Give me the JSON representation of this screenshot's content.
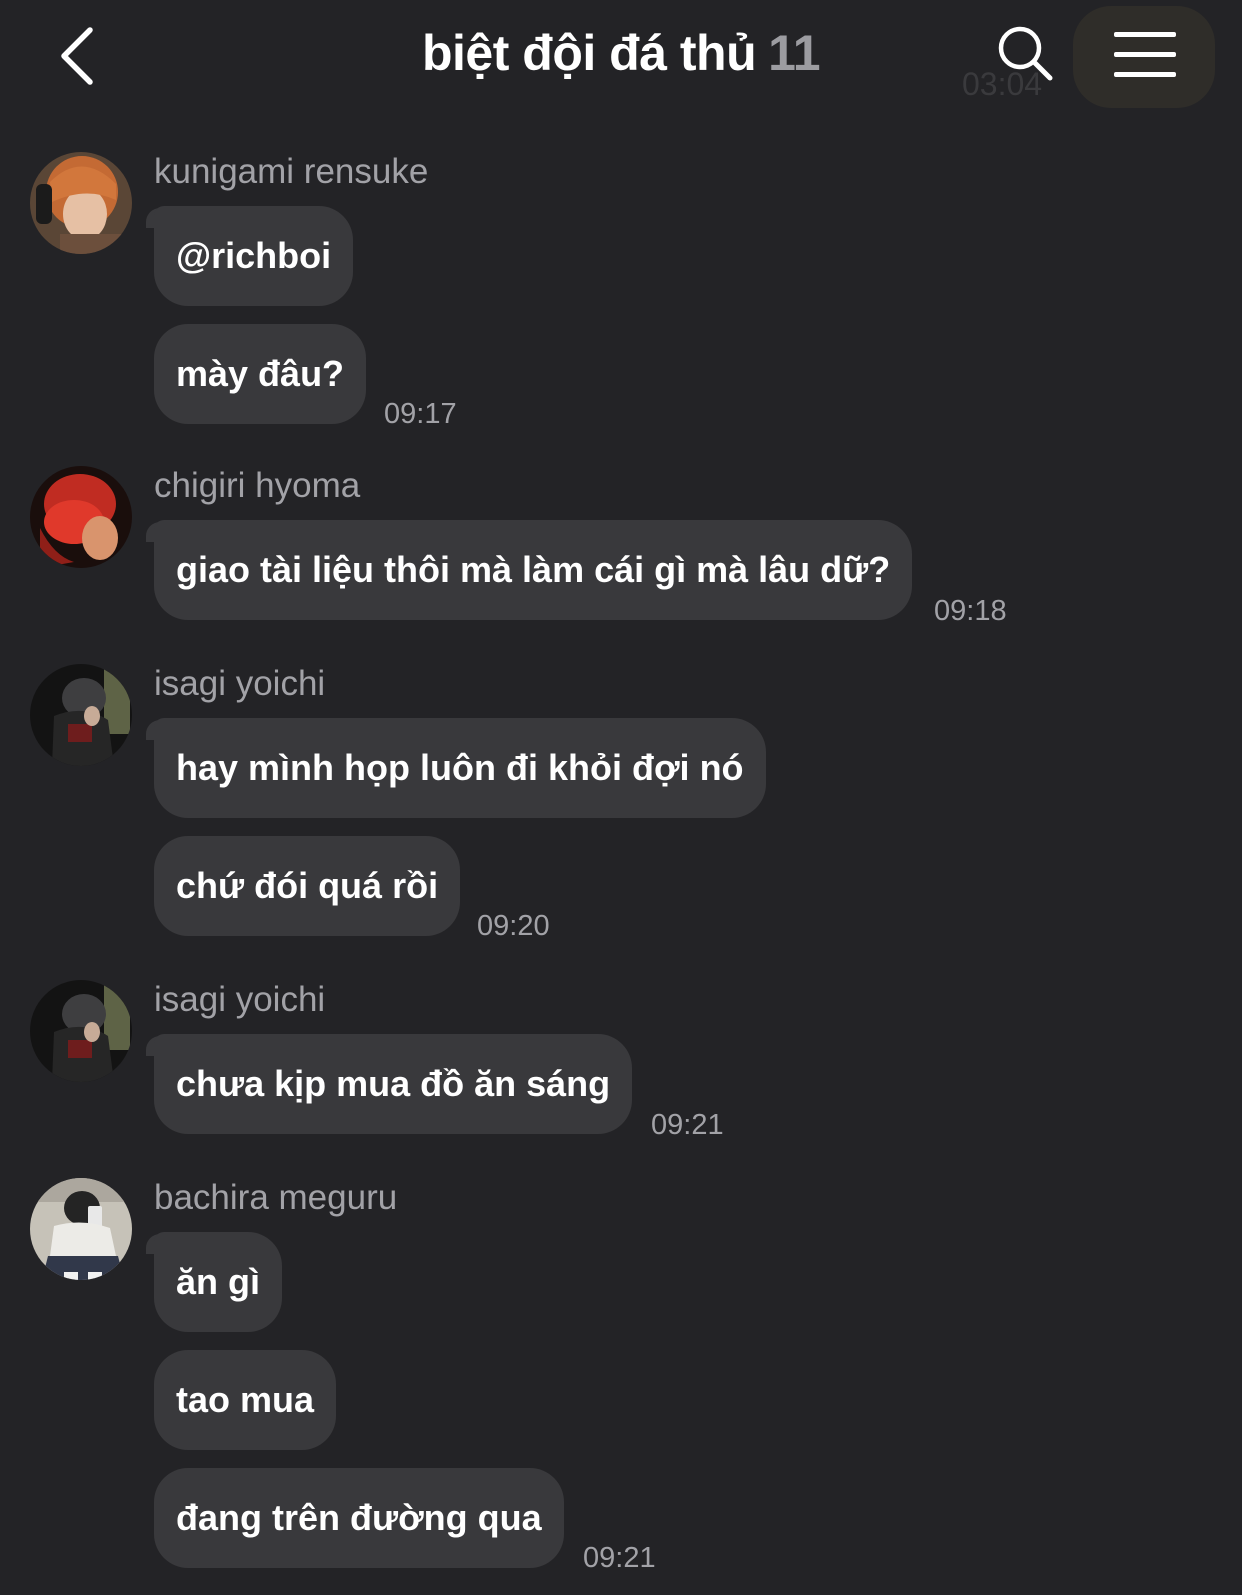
{
  "header": {
    "title": "biệt đội đá thủ",
    "member_count": "11",
    "back_icon": "chevron-left-icon",
    "search_icon": "search-icon",
    "menu_icon": "hamburger-menu-icon",
    "ghost_time": "03:04"
  },
  "messages": [
    {
      "sender": "kunigami rensuke",
      "bubbles": [
        "@richboi",
        "mày đâu?"
      ],
      "time": "09:17"
    },
    {
      "sender": "chigiri hyoma",
      "bubbles": [
        "giao tài liệu thôi mà làm cái gì mà lâu dữ?"
      ],
      "time": "09:18"
    },
    {
      "sender": "isagi yoichi",
      "bubbles": [
        "hay mình họp luôn đi khỏi đợi nó",
        "chứ đói quá rồi"
      ],
      "time": "09:20"
    },
    {
      "sender": "isagi yoichi",
      "bubbles": [
        "chưa kịp mua đồ ăn sáng"
      ],
      "time": "09:21"
    },
    {
      "sender": "bachira meguru",
      "bubbles": [
        "ăn gì",
        "tao mua",
        "đang trên đường qua"
      ],
      "time": "09:21"
    }
  ],
  "colors": {
    "background": "#232326",
    "bubble": "#39393c",
    "secondary_text": "#a2a2a7",
    "primary_text": "#ffffff"
  }
}
